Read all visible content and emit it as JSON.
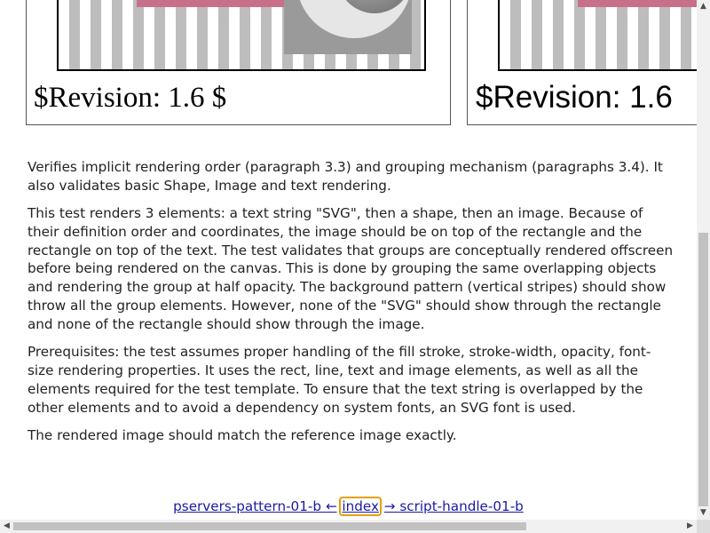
{
  "panels": {
    "left_revision": "$Revision: 1.6 $",
    "right_revision": "$Revision: 1.6"
  },
  "description": {
    "p1": "Verifies implicit rendering order (paragraph 3.3) and grouping mechanism (paragraphs 3.4). It also validates basic Shape, Image and text rendering.",
    "p2": "This test renders 3 elements: a text string \"SVG\", then a shape, then an image. Because of their definition order and coordinates, the image should be on top of the rectangle and the rectangle on top of the text. The test validates that groups are conceptually rendered offscreen before being rendered on the canvas. This is done by grouping the same overlapping objects and rendering the group at half opacity. The background pattern (vertical stripes) should show throw all the group elements. However, none of the \"SVG\" should show through the rectangle and none of the rectangle should show through the image.",
    "p3": "Prerequisites: the test assumes proper handling of the fill stroke, stroke-width, opacity, font-size rendering properties. It uses the rect, line, text and image elements, as well as all the elements required for the test template. To ensure that the text string is overlapped by the other elements and to avoid a dependency on system fonts, an SVG font is used.",
    "p4": "The rendered image should match the reference image exactly."
  },
  "nav": {
    "prev": "pservers-pattern-01-b ←",
    "index": "index",
    "next": "→ script-handle-01-b"
  },
  "colors": {
    "link": "#1a1aa6",
    "focus_outline": "#e5a000",
    "pink_bar": "#c8708a"
  },
  "icons": {
    "scroll_up": "▲",
    "scroll_down": "▼",
    "scroll_left": "◀",
    "scroll_right": "▶"
  }
}
